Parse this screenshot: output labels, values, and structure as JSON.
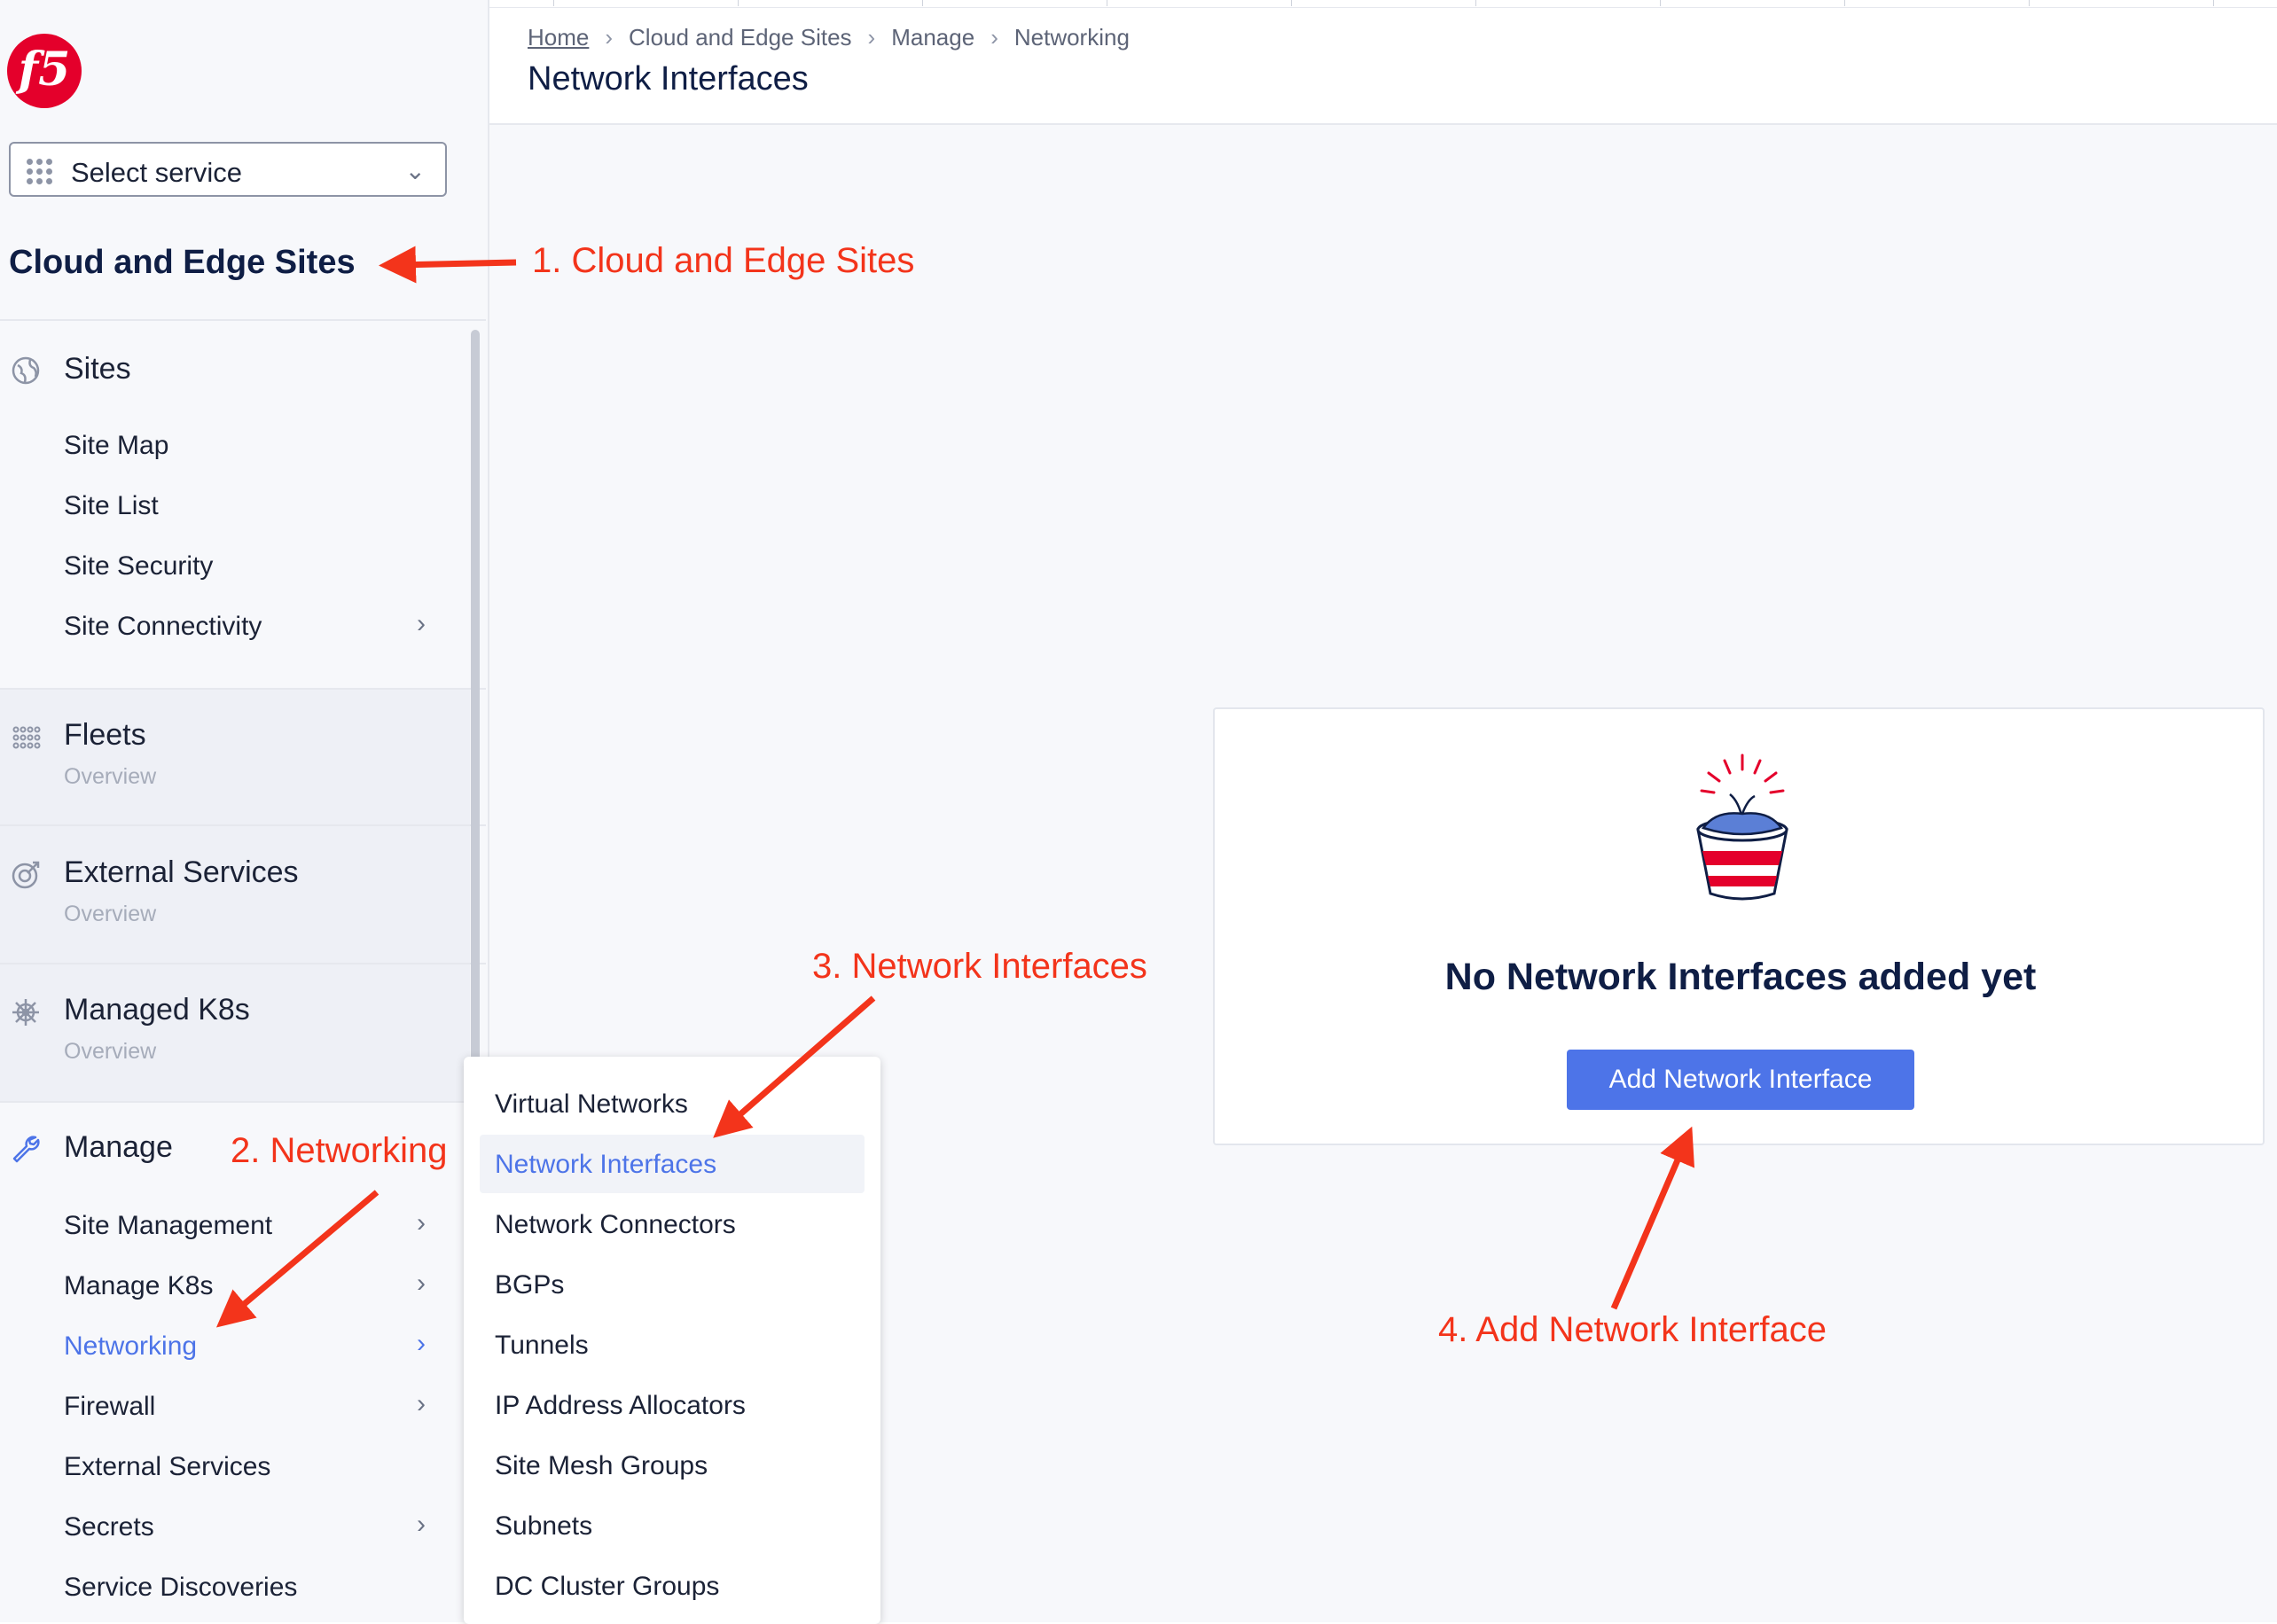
{
  "sidebar": {
    "logo_text": "f5",
    "select_service": "Select service",
    "service_title": "Cloud and Edge Sites",
    "sites": {
      "title": "Sites",
      "items": [
        {
          "label": "Site Map"
        },
        {
          "label": "Site List"
        },
        {
          "label": "Site Security"
        },
        {
          "label": "Site Connectivity"
        }
      ]
    },
    "fleets": {
      "title": "Fleets",
      "subtitle": "Overview"
    },
    "external_services": {
      "title": "External Services",
      "subtitle": "Overview"
    },
    "managed_k8s": {
      "title": "Managed K8s",
      "subtitle": "Overview"
    },
    "manage": {
      "title": "Manage",
      "items": [
        {
          "label": "Site Management"
        },
        {
          "label": "Manage K8s"
        },
        {
          "label": "Networking"
        },
        {
          "label": "Firewall"
        },
        {
          "label": "External Services"
        },
        {
          "label": "Secrets"
        },
        {
          "label": "Service Discoveries"
        }
      ]
    }
  },
  "header": {
    "breadcrumb": [
      "Home",
      "Cloud and Edge Sites",
      "Manage",
      "Networking"
    ],
    "title": "Network Interfaces"
  },
  "empty_state": {
    "title": "No Network Interfaces added yet",
    "button": "Add Network Interface"
  },
  "submenu": {
    "items": [
      {
        "label": "Virtual Networks"
      },
      {
        "label": "Network Interfaces"
      },
      {
        "label": "Network Connectors"
      },
      {
        "label": "BGPs"
      },
      {
        "label": "Tunnels"
      },
      {
        "label": "IP Address Allocators"
      },
      {
        "label": "Site Mesh Groups"
      },
      {
        "label": "Subnets"
      },
      {
        "label": "DC Cluster Groups"
      }
    ]
  },
  "annotations": {
    "step1": "1. Cloud and Edge Sites",
    "step2": "2. Networking",
    "step3": "3. Network Interfaces",
    "step4": "4. Add Network Interface"
  },
  "colors": {
    "accent": "#4d74e8",
    "annotation": "#f3341b",
    "logo": "#e4002b"
  },
  "icons": {
    "sites": "globe-icon",
    "fleets": "fleet-icon",
    "external_services": "target-icon",
    "managed_k8s": "helm-icon",
    "manage": "wrench-icon"
  }
}
